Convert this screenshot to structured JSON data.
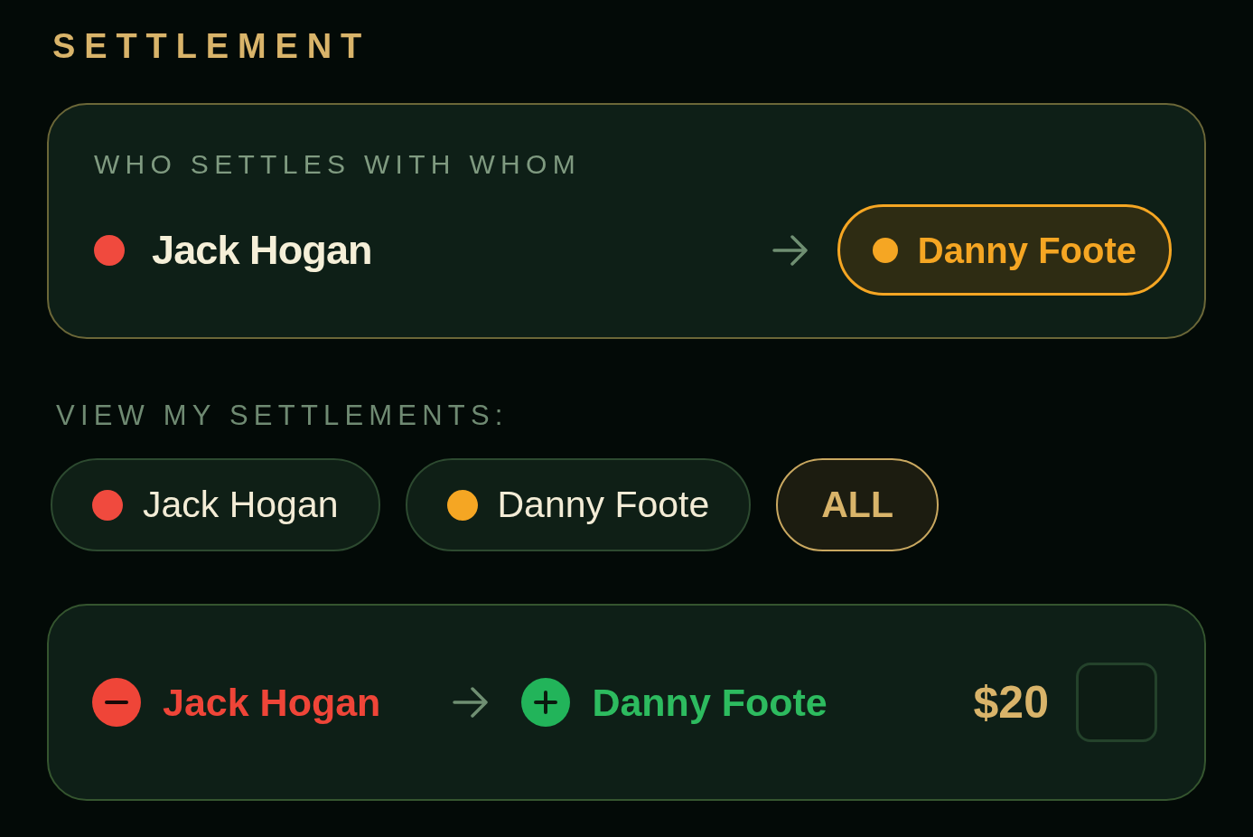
{
  "section_title": "SETTLEMENT",
  "pair_card": {
    "label": "WHO SETTLES WITH WHOM",
    "from": {
      "name": "Jack Hogan",
      "color": "#f04a3e"
    },
    "to": {
      "name": "Danny Foote",
      "color": "#f5a623"
    }
  },
  "filter": {
    "label": "VIEW MY SETTLEMENTS:",
    "options": [
      {
        "label": "Jack Hogan",
        "color": "#f04a3e",
        "selected": false
      },
      {
        "label": "Danny Foote",
        "color": "#f5a623",
        "selected": false
      },
      {
        "label": "ALL",
        "selected": true
      }
    ]
  },
  "settlements": [
    {
      "payer": "Jack Hogan",
      "payee": "Danny Foote",
      "amount": "$20",
      "checked": false
    }
  ]
}
